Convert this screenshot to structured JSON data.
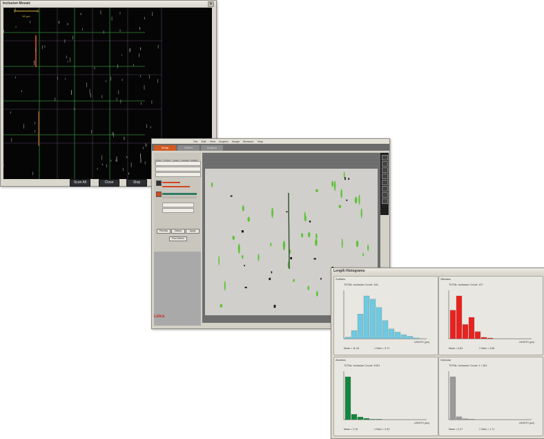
{
  "mosaic": {
    "title": "Inclusion Mosaic",
    "scale_label": "50 µm",
    "buttons": [
      "Scan All",
      "Close",
      "Stop"
    ]
  },
  "detection": {
    "menu": [
      "File",
      "Edit",
      "View",
      "Acquire",
      "Image",
      "Measure",
      "Help"
    ],
    "tabs": [
      "Setup",
      "Detect",
      "Analyze"
    ],
    "sidebar_tabs": [
      "Glob",
      "Color",
      "Area",
      "Length",
      "Width"
    ],
    "sidebar_buttons": [
      "Preview",
      "Detect",
      "Apply"
    ],
    "run_button": "Run Detect",
    "logo": "Leica"
  },
  "histograms": {
    "title": "Length Histograms",
    "x_axis": "LENGTH (µm)",
    "panels": [
      {
        "name": "Sulfides",
        "count": "TOTAL Inclusion Count: 161",
        "mean": "Mean = 11.18",
        "stdev": "1 Sdev = 5.71",
        "color": "#6fc9e0"
      },
      {
        "name": "Silicates",
        "count": "TOTAL Inclusion Count: 117",
        "mean": "Mean = 5.83",
        "stdev": "1 Sdev = 4.66",
        "color": "#e8231f"
      },
      {
        "name": "Alumina",
        "count": "TOTAL Inclusion Count: 1051",
        "mean": "Mean = 2.15",
        "stdev": "1 Sdev = 2.33",
        "color": "#14863e"
      },
      {
        "name": "Globular",
        "count": "TOTAL Inclusion Count: 1 / 161",
        "mean": "Mean = 2.27",
        "stdev": "1 Sdev = 1.71",
        "color": "#9a9a9a"
      }
    ]
  }
}
